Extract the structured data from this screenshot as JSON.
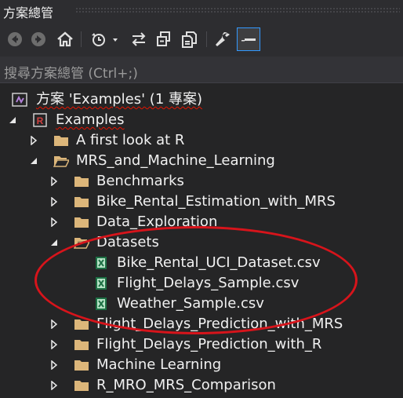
{
  "window": {
    "title": "方案總管"
  },
  "toolbar": {
    "buttons": [
      {
        "name": "back-button",
        "icon": "arrow-left-circle-icon"
      },
      {
        "name": "forward-button",
        "icon": "arrow-right-circle-icon"
      },
      {
        "name": "home-button",
        "icon": "home-icon"
      },
      {
        "name": "pending-changes-button",
        "icon": "history-icon"
      },
      {
        "name": "sync-button",
        "icon": "sync-arrows-icon"
      },
      {
        "name": "collapse-all-button",
        "icon": "collapse-all-icon"
      },
      {
        "name": "show-all-files-button",
        "icon": "copy-files-icon"
      },
      {
        "name": "properties-button",
        "icon": "wrench-icon"
      },
      {
        "name": "preview-button",
        "icon": "preview-icon"
      }
    ]
  },
  "search": {
    "placeholder": "搜尋方案總管 (Ctrl+;)"
  },
  "tree": {
    "solution": "方案 'Examples' (1 專案)",
    "project": "Examples",
    "items": [
      {
        "label": "A first look at R",
        "type": "folder",
        "expanded": false
      },
      {
        "label": "MRS_and_Machine_Learning",
        "type": "folder",
        "expanded": true
      },
      {
        "label": "Benchmarks",
        "type": "folder",
        "expanded": false
      },
      {
        "label": "Bike_Rental_Estimation_with_MRS",
        "type": "folder",
        "expanded": false
      },
      {
        "label": "Data_Exploration",
        "type": "folder",
        "expanded": false
      },
      {
        "label": "Datasets",
        "type": "folder",
        "expanded": true
      },
      {
        "label": "Bike_Rental_UCI_Dataset.csv",
        "type": "csv"
      },
      {
        "label": "Flight_Delays_Sample.csv",
        "type": "csv"
      },
      {
        "label": "Weather_Sample.csv",
        "type": "csv"
      },
      {
        "label": "Flight_Delays_Prediction_with_MRS",
        "type": "folder",
        "expanded": false
      },
      {
        "label": "Flight_Delays_Prediction_with_R",
        "type": "folder",
        "expanded": false
      },
      {
        "label": "Machine Learning",
        "type": "folder",
        "expanded": false
      },
      {
        "label": "R_MRO_MRS_Comparison",
        "type": "folder",
        "expanded": false
      }
    ]
  },
  "colors": {
    "background": "#252526",
    "folder": "#dcb67a",
    "csv_icon": "#1e7145",
    "highlight_ellipse": "#d7141b",
    "active_border": "#3399ff"
  }
}
